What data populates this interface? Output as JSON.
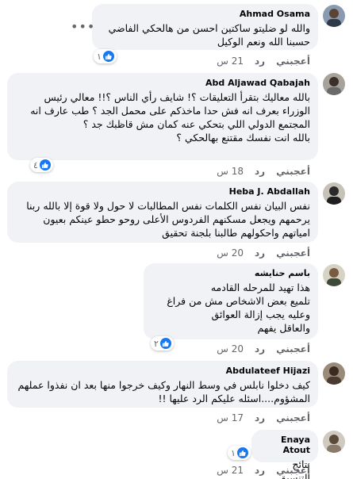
{
  "comments": [
    {
      "name": "Ahmad Osama",
      "text": "والله لو ضليتو ساكتين احسن من هالحكي الفاضي\nحسبنا الله ونعم الوكيل",
      "like": "أعجبني",
      "reply": "رد",
      "time": "21 س",
      "reactions": "١"
    },
    {
      "name": "Abd Aljawad Qabajah",
      "text": "بالله معاليك بتقرأ التعليقات ؟! شايف رأي الناس ؟!! معالي رئيس الوزراء بعرف انه فش حدا ماخذكم على محمل الجد ؟ طب عارف انه المجتمع الدولي اللي بتحكي عنه كمان مش قاظبك جد ؟\nبالله انت نفسك مقتنع بهالحكي ؟",
      "like": "أعجبني",
      "reply": "رد",
      "time": "18 س",
      "reactions": "٤"
    },
    {
      "name": "Heba J. Abdallah",
      "text": "نفس البيان نفس الكلمات نفس المطالبات لا حول ولا قوة إلا بالله ربنا يرحمهم ويجعل مسكنهم الفردوس الأعلى روحو حطو عينكم بعيون امياتهم واحكولهم طالبنا بلجنة تحقيق",
      "like": "أعجبني",
      "reply": "رد",
      "time": "20 س",
      "reactions": ""
    },
    {
      "name": "باسم حنايشه",
      "text": "هذا تهيد للمرحله القادمه\nتلميع بعض الاشخاص مش من فراغ\nوعليه يجب إزالة العوائق\nوالعاقل يفهم",
      "like": "أعجبني",
      "reply": "رد",
      "time": "20 س",
      "reactions": "٢"
    },
    {
      "name": "Abdulateef Hijazi",
      "text": "كيف دخلوا نابلس في وسط النهار وكيف خرجوا منها بعد ان نفذوا عملهم المشؤوم....اسئله عليكم الرد عليها !!",
      "like": "أعجبني",
      "reply": "رد",
      "time": "17 س",
      "reactions": ""
    },
    {
      "name": "Enaya Atout",
      "text": "نتائج التنسيق",
      "like": "أعجبني",
      "reply": "رد",
      "time": "21 س",
      "reactions": "١"
    }
  ]
}
